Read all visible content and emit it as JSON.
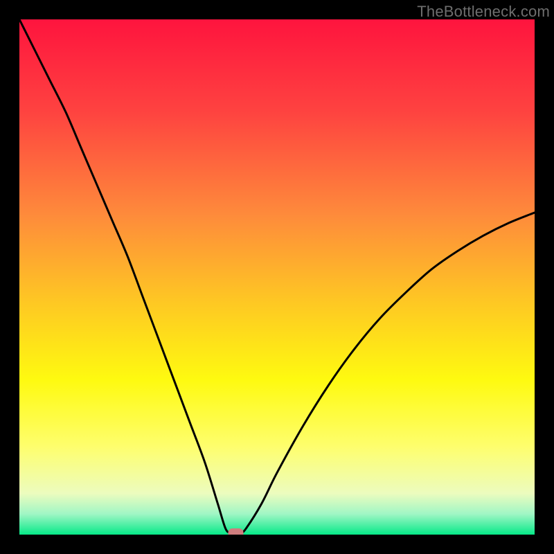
{
  "watermark": "TheBottleneck.com",
  "chart_data": {
    "type": "line",
    "title": "",
    "xlabel": "",
    "ylabel": "",
    "xlim": [
      0,
      100
    ],
    "ylim": [
      0,
      100
    ],
    "grid": false,
    "series": [
      {
        "name": "bottleneck-curve",
        "x_pct": [
          0,
          3,
          6,
          9,
          12,
          15,
          18,
          21,
          24,
          27,
          30,
          33,
          36,
          38.5,
          40,
          41,
          42,
          43,
          44,
          47,
          50,
          55,
          60,
          65,
          70,
          75,
          80,
          85,
          90,
          95,
          100
        ],
        "y_pct": [
          100,
          94,
          88,
          82,
          75,
          68,
          61,
          54,
          46,
          38,
          30,
          22,
          14,
          6,
          1.2,
          0.3,
          0,
          0.3,
          1.2,
          6,
          12,
          21,
          29,
          36,
          42,
          47,
          51.5,
          55,
          58,
          60.5,
          62.5
        ],
        "note": "y = bottleneck percentage; minimum at x≈42 where y=0"
      }
    ],
    "marker": {
      "x_pct": 42,
      "y_pct": 0,
      "color": "#cf7d7e",
      "shape": "rounded-rect"
    },
    "background_gradient_stops": [
      {
        "pos_pct": 0,
        "color": "#fe143e"
      },
      {
        "pos_pct": 18,
        "color": "#fe4340"
      },
      {
        "pos_pct": 38,
        "color": "#fe8b3b"
      },
      {
        "pos_pct": 55,
        "color": "#fec823"
      },
      {
        "pos_pct": 70,
        "color": "#fefa10"
      },
      {
        "pos_pct": 83,
        "color": "#fefe6e"
      },
      {
        "pos_pct": 92,
        "color": "#ecfcbe"
      },
      {
        "pos_pct": 96,
        "color": "#a0f6c5"
      },
      {
        "pos_pct": 100,
        "color": "#06e988"
      }
    ]
  }
}
